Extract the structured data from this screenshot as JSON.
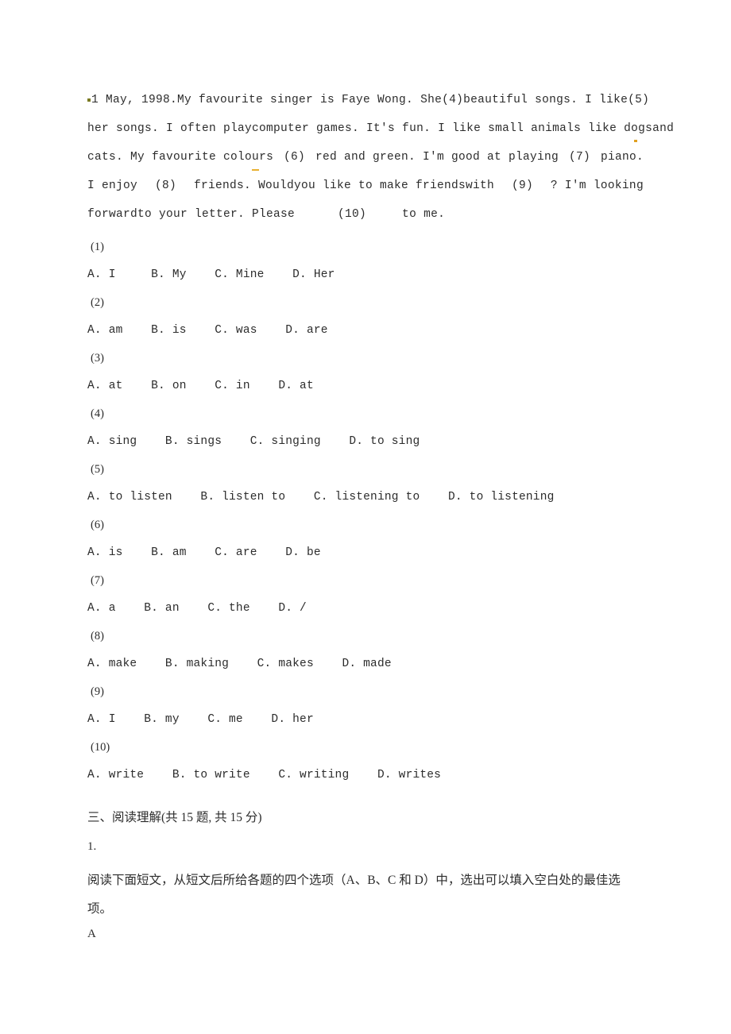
{
  "document": {
    "background_color": "#ffffff",
    "text_color": "#2c2c2c",
    "spellcheck_mark_color": "#e0a020",
    "lead_mark_color": "#7a7a22"
  },
  "passage": {
    "lines": [
      {
        "segments": [
          "1 May, 1998.",
          "My favourite singer is Faye Wong. She",
          "(4)",
          "beautiful songs. I like",
          "(5)"
        ],
        "full_text": "1 May, 1998.My favourite singer is Faye Wong. She  (4)   beautiful songs. I like   (5)"
      },
      {
        "segments": [
          "her songs. I often playcomputer games. It's fun. I like small animals like dogsand"
        ],
        "full_text": "her songs. I often playcomputer games. It's fun. I like small animals like dogsand"
      },
      {
        "segments": [
          "cats. My favourite colours",
          "(6)",
          "red and green. I'm good at playing",
          "(7)",
          "piano."
        ],
        "full_text": "cats. My favourite colours   (6)   red and green. I'm good at playing   (7)   piano."
      },
      {
        "segments": [
          "I enjoy",
          "(8)",
          "friends. Wouldyou like to make friendswith",
          "(9)",
          "? I'm looking"
        ],
        "full_text": "I enjoy   (8)    friends. Wouldyou like to make friendswith   (9)   ? I'm looking"
      },
      {
        "segments": [
          "forwardto your letter. Please",
          "(10)",
          "to me."
        ],
        "full_text": "forwardto your letter. Please   (10)   to me."
      }
    ],
    "line1_a": "1 May, 1998.My favourite singer is Faye Wong. She",
    "line1_b": "(4)",
    "line1_c": "beautiful songs. I like",
    "line1_d": "(5)",
    "line2_a": "her songs. I often playcomputer games. It's fun. I like small animals like d",
    "line2_dot": "o",
    "line2_b": "gsand",
    "line3_a": "cats. My favourite colo",
    "line3_ul": "u",
    "line3_b": "rs",
    "line3_c": "(6)",
    "line3_d": "red and green. I'm good at playing",
    "line3_e": "(7)",
    "line3_f": "piano.",
    "line4_a": "I enjoy",
    "line4_b": "(8)",
    "line4_c": "friends. Wouldyou like to make friendswith",
    "line4_d": "(9)",
    "line4_e": "? I'm looking",
    "line5": "forwardto your letter. Please      (10)     to me."
  },
  "questions": [
    {
      "number": "(1)",
      "options": "A. I     B. My    C. Mine    D. Her"
    },
    {
      "number": "(2)",
      "options": "A. am    B. is    C. was    D. are"
    },
    {
      "number": "(3)",
      "options": "A. at    B. on    C. in    D. at"
    },
    {
      "number": "(4)",
      "options": "A. sing    B. sings    C. singing    D. to sing"
    },
    {
      "number": "(5)",
      "options": "A. to listen    B. listen to    C. listening to    D. to listening"
    },
    {
      "number": "(6)",
      "options": "A. is    B. am    C. are    D. be"
    },
    {
      "number": "(7)",
      "options": "A. a    B. an    C. the    D. /"
    },
    {
      "number": "(8)",
      "options": "A. make    B. making    C. makes    D. made"
    },
    {
      "number": "(9)",
      "options": "A. I    B. my    C. me    D. her"
    },
    {
      "number": "(10)",
      "options": "A. write    B. to write    C. writing    D. writes"
    }
  ],
  "reading_section": {
    "heading": "三、阅读理解(共 15 题, 共 15 分)",
    "item_number": "1.",
    "instruction_line1": "阅读下面短文，从短文后所给各题的四个选项（A、B、C 和 D）中，选出可以填入空白处的最佳选",
    "instruction_line2": "项。",
    "passage_label": "A"
  }
}
